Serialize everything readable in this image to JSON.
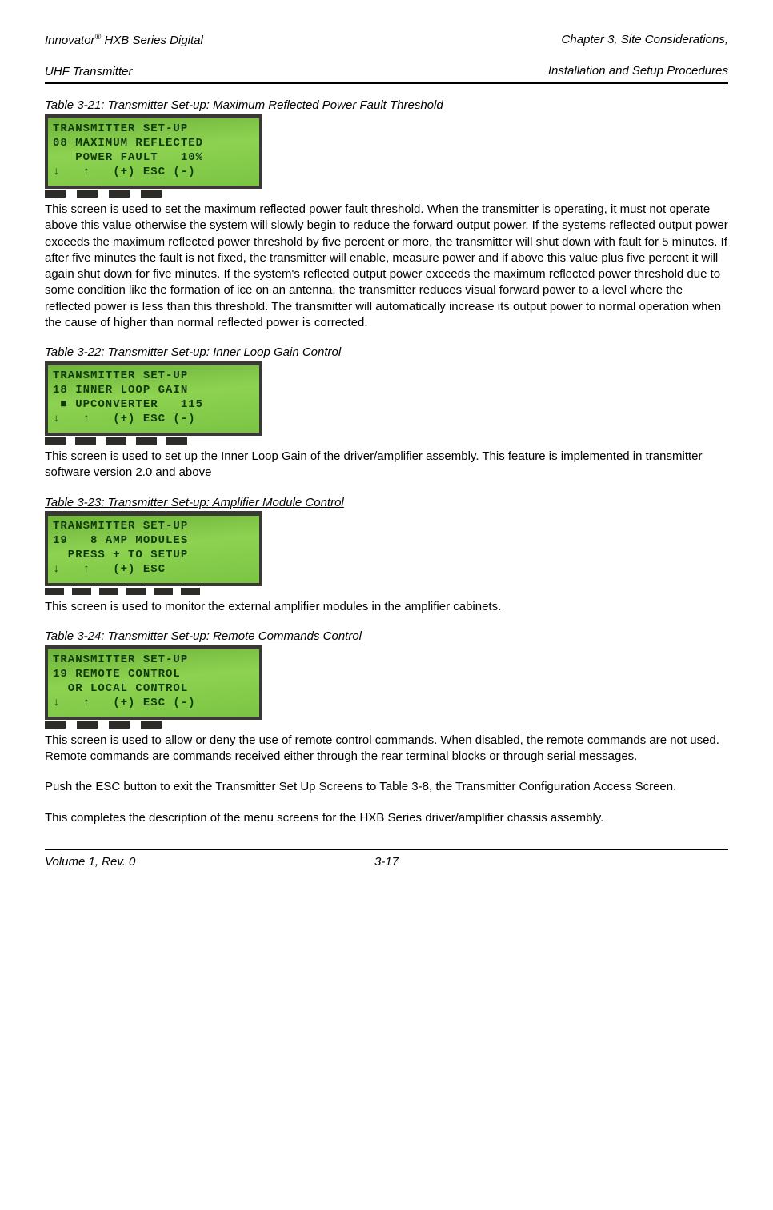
{
  "header": {
    "left_line1": "Innovator",
    "left_reg": "®",
    "left_line1b": " HXB Series Digital",
    "left_line2": "UHF Transmitter",
    "right_line1": "Chapter 3, Site Considerations,",
    "right_line2": "Installation and Setup Procedures"
  },
  "sections": [
    {
      "caption": "Table 3-21: Transmitter Set-up: Maximum Reflected Power Fault Threshold",
      "lcd": [
        "TRANSMITTER SET-UP",
        "08 MAXIMUM REFLECTED",
        "   POWER FAULT   10%",
        "↓   ↑   (+) ESC (-)"
      ],
      "tabs": 4,
      "body": "This screen is used to set the maximum reflected power fault threshold.  When the transmitter is operating, it must not operate above this value otherwise the system will slowly begin to reduce the forward output power.  If the systems reflected output power exceeds the maximum reflected power threshold by five percent or more, the transmitter will shut down with fault for 5 minutes.  If after five minutes the fault is not fixed, the transmitter will enable, measure power and if above this value plus five percent it will again shut down for five minutes.  If the system's reflected output power exceeds the maximum reflected power threshold due to some condition like the formation of ice on an antenna, the transmitter reduces visual forward power to a level where the reflected power is less than this threshold.  The transmitter will automatically increase its output power to normal operation when the cause of higher than normal reflected power is corrected."
    },
    {
      "caption": "Table 3-22: Transmitter Set-up: Inner Loop Gain Control",
      "lcd": [
        "TRANSMITTER SET-UP",
        "18 INNER LOOP GAIN",
        " ■ UPCONVERTER   115",
        "↓   ↑   (+) ESC (-)"
      ],
      "tabs": 5,
      "body": "This screen is used to set up the Inner Loop Gain of the driver/amplifier assembly.  This feature is implemented in transmitter software version 2.0 and above"
    },
    {
      "caption": "Table 3-23: Transmitter Set-up: Amplifier Module Control",
      "lcd": [
        "TRANSMITTER SET-UP",
        "19   8 AMP MODULES",
        "  PRESS + TO SETUP",
        "↓   ↑   (+) ESC"
      ],
      "tabs": 6,
      "body": "This screen is used to monitor the external amplifier modules in the amplifier cabinets."
    },
    {
      "caption": "Table 3-24: Transmitter Set-up: Remote Commands Control",
      "lcd": [
        "TRANSMITTER SET-UP",
        "19 REMOTE CONTROL",
        "  OR LOCAL CONTROL",
        "↓   ↑   (+) ESC (-)"
      ],
      "tabs": 4,
      "body": "This screen is used to allow or deny the use of remote control commands.  When disabled, the remote commands are not used.  Remote commands are commands received either through the rear terminal blocks or through serial messages."
    }
  ],
  "trailing": [
    "Push the ESC button to exit the Transmitter Set Up Screens to Table 3-8, the Transmitter Configuration Access Screen.",
    "This completes the description of the menu screens for the HXB Series driver/amplifier chassis assembly."
  ],
  "footer": {
    "left": "Volume 1, Rev. 0",
    "center": "3-17"
  }
}
